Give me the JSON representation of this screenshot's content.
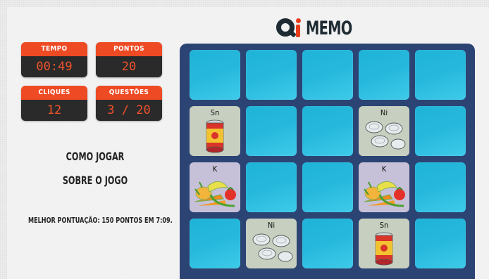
{
  "header": {
    "title": "MEMO",
    "logo": "qi-logo"
  },
  "stats": {
    "time": {
      "label": "TEMPO",
      "value": "00:49"
    },
    "points": {
      "label": "PONTOS",
      "value": "20"
    },
    "clicks": {
      "label": "CLIQUES",
      "value": "12"
    },
    "questions": {
      "label": "QUESTÕES",
      "value": "3 / 20"
    }
  },
  "links": {
    "how_to_play": "COMO JOGAR",
    "about": "SOBRE O JOGO"
  },
  "best_score": "MELHOR PONTUAÇÃO: 150 PONTOS EM 7:09.",
  "board": {
    "rows": 4,
    "cols": 5,
    "revealed": [
      {
        "row": 1,
        "col": 0,
        "symbol": "Sn",
        "image": "can-icon"
      },
      {
        "row": 1,
        "col": 3,
        "symbol": "Ni",
        "image": "coins-icon"
      },
      {
        "row": 2,
        "col": 0,
        "symbol": "K",
        "image": "vegetables-icon"
      },
      {
        "row": 2,
        "col": 3,
        "symbol": "K",
        "image": "vegetables-icon"
      },
      {
        "row": 3,
        "col": 1,
        "symbol": "Ni",
        "image": "coins-icon"
      },
      {
        "row": 3,
        "col": 3,
        "symbol": "Sn",
        "image": "can-icon"
      }
    ],
    "colors": {
      "board": "#2c4474",
      "card_back": "#27b9dd",
      "accent": "#ee4a23"
    }
  }
}
